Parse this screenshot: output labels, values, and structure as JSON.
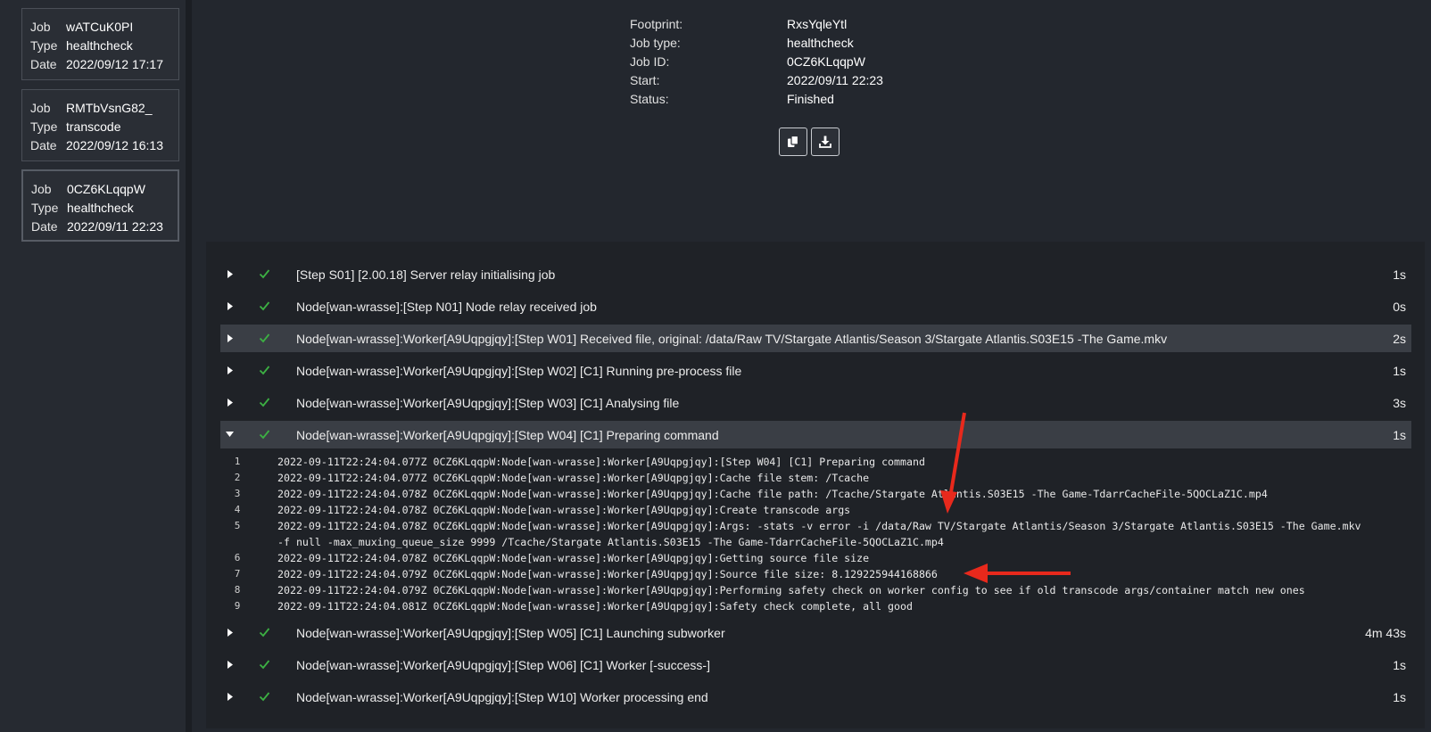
{
  "sidebar": {
    "jobs": [
      {
        "job_label": "Job",
        "job": "wATCuK0PI",
        "type_label": "Type",
        "type": "healthcheck",
        "date_label": "Date",
        "date": "2022/09/12 17:17"
      },
      {
        "job_label": "Job",
        "job": "RMTbVsnG82_",
        "type_label": "Type",
        "type": "transcode",
        "date_label": "Date",
        "date": "2022/09/12 16:13"
      },
      {
        "job_label": "Job",
        "job": "0CZ6KLqqpW",
        "type_label": "Type",
        "type": "healthcheck",
        "date_label": "Date",
        "date": "2022/09/11 22:23"
      }
    ]
  },
  "info": {
    "footprint_label": "Footprint:",
    "footprint": "RxsYqleYtl",
    "jobtype_label": "Job type:",
    "jobtype": "healthcheck",
    "jobid_label": "Job ID:",
    "jobid": "0CZ6KLqqpW",
    "start_label": "Start:",
    "start": "2022/09/11 22:23",
    "status_label": "Status:",
    "status": "Finished"
  },
  "toolbar": {
    "copy_icon": "copy-icon",
    "download_icon": "download-icon"
  },
  "colors": {
    "check": "#3cb043",
    "arrow": "#e8291c"
  },
  "steps": [
    {
      "text": "[Step S01] [2.00.18] Server relay initialising job",
      "duration": "1s"
    },
    {
      "text": "Node[wan-wrasse]:[Step N01] Node relay received job",
      "duration": "0s"
    },
    {
      "text": "Node[wan-wrasse]:Worker[A9Uqpgjqy]:[Step W01] Received file, original: /data/Raw TV/Stargate Atlantis/Season 3/Stargate Atlantis.S03E15 -The Game.mkv",
      "duration": "2s"
    },
    {
      "text": "Node[wan-wrasse]:Worker[A9Uqpgjqy]:[Step W02] [C1] Running pre-process file",
      "duration": "1s"
    },
    {
      "text": "Node[wan-wrasse]:Worker[A9Uqpgjqy]:[Step W03] [C1] Analysing file",
      "duration": "3s"
    },
    {
      "text": "Node[wan-wrasse]:Worker[A9Uqpgjqy]:[Step W04] [C1] Preparing command",
      "duration": "1s"
    },
    {
      "text": "Node[wan-wrasse]:Worker[A9Uqpgjqy]:[Step W05] [C1] Launching subworker",
      "duration": "4m 43s"
    },
    {
      "text": "Node[wan-wrasse]:Worker[A9Uqpgjqy]:[Step W06] [C1] Worker [-success-]",
      "duration": "1s"
    },
    {
      "text": "Node[wan-wrasse]:Worker[A9Uqpgjqy]:[Step W10] Worker processing end",
      "duration": "1s"
    }
  ],
  "log": [
    {
      "n": "1",
      "text": "2022-09-11T22:24:04.077Z 0CZ6KLqqpW:Node[wan-wrasse]:Worker[A9Uqpgjqy]:[Step W04] [C1] Preparing command"
    },
    {
      "n": "2",
      "text": "2022-09-11T22:24:04.077Z 0CZ6KLqqpW:Node[wan-wrasse]:Worker[A9Uqpgjqy]:Cache file stem: /Tcache"
    },
    {
      "n": "3",
      "text": "2022-09-11T22:24:04.078Z 0CZ6KLqqpW:Node[wan-wrasse]:Worker[A9Uqpgjqy]:Cache file path: /Tcache/Stargate Atlantis.S03E15 -The Game-TdarrCacheFile-5QOCLaZ1C.mp4"
    },
    {
      "n": "4",
      "text": "2022-09-11T22:24:04.078Z 0CZ6KLqqpW:Node[wan-wrasse]:Worker[A9Uqpgjqy]:Create transcode args"
    },
    {
      "n": "5",
      "text": "2022-09-11T22:24:04.078Z 0CZ6KLqqpW:Node[wan-wrasse]:Worker[A9Uqpgjqy]:Args: -stats -v error -i /data/Raw TV/Stargate Atlantis/Season 3/Stargate Atlantis.S03E15 -The Game.mkv\n-f null -max_muxing_queue_size 9999 /Tcache/Stargate Atlantis.S03E15 -The Game-TdarrCacheFile-5QOCLaZ1C.mp4"
    },
    {
      "n": "6",
      "text": "2022-09-11T22:24:04.078Z 0CZ6KLqqpW:Node[wan-wrasse]:Worker[A9Uqpgjqy]:Getting source file size"
    },
    {
      "n": "7",
      "text": "2022-09-11T22:24:04.079Z 0CZ6KLqqpW:Node[wan-wrasse]:Worker[A9Uqpgjqy]:Source file size: 8.129225944168866"
    },
    {
      "n": "8",
      "text": "2022-09-11T22:24:04.079Z 0CZ6KLqqpW:Node[wan-wrasse]:Worker[A9Uqpgjqy]:Performing safety check on worker config to see if old transcode args/container match new ones"
    },
    {
      "n": "9",
      "text": "2022-09-11T22:24:04.081Z 0CZ6KLqqpW:Node[wan-wrasse]:Worker[A9Uqpgjqy]:Safety check complete, all good"
    }
  ]
}
